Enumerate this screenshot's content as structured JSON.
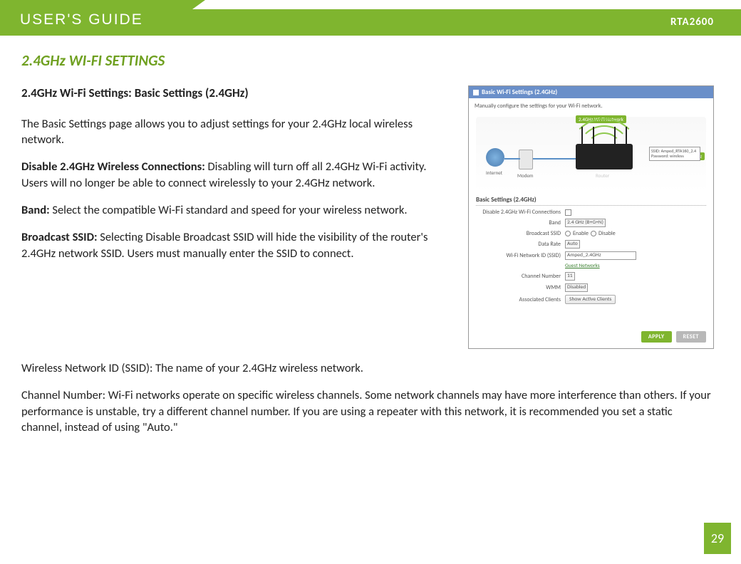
{
  "header": {
    "title": "USER'S GUIDE",
    "model": "RTA2600"
  },
  "section_title": "2.4GHz WI-FI SETTINGS",
  "sub_title": "2.4GHz Wi-Fi Settings: Basic Settings (2.4GHz)",
  "intro": "The Basic Settings page allows you to adjust settings for your 2.4GHz local wireless network.",
  "items": {
    "disable": {
      "label": "Disable 2.4GHz Wireless Connections: ",
      "text": "Disabling will turn off all 2.4GHz Wi-Fi activity. Users will no longer be able to connect wirelessly to your 2.4GHz network."
    },
    "band": {
      "label": "Band: ",
      "text": "Select the compatible Wi-Fi standard and speed for your wireless network."
    },
    "broadcast": {
      "label": "Broadcast SSID: ",
      "text": "Selecting Disable Broadcast SSID will hide the visibility of the router's 2.4GHz network SSID. Users must manually enter the SSID to connect."
    },
    "ssid": {
      "label": "Wireless Network ID (SSID): ",
      "text": "The name of your 2.4GHz wireless network."
    },
    "channel": {
      "label": "Channel Number: ",
      "text": "Wi-Fi networks operate on specific wireless channels. Some network channels may have more interference than others. If your performance is unstable, try a different channel number. If you are using a repeater with this network, it is recommended you set a static channel, instead of using \"Auto.\""
    }
  },
  "screenshot": {
    "panel_title": "Basic Wi-Fi Settings (2.4GHz)",
    "panel_desc": "Manually configure the settings for your Wi-Fi network.",
    "badge_network": "2.4GHz Wi-Fi Network",
    "badge_freq": "2.4GHz",
    "diagram_internet": "Internet",
    "diagram_modem": "Modem",
    "diagram_router": "Router",
    "ssid_box_line1": "SSID: Amped_RTA160_2.4",
    "ssid_box_line2": "Password: wireless",
    "form_title": "Basic Settings (2.4GHz)",
    "rows": {
      "disable": "Disable 2.4GHz Wi-Fi Connections",
      "band": "Band",
      "band_val": "2.4 GHz (B+G+N)",
      "broadcast": "Broadcast SSID",
      "broadcast_enable": "Enable",
      "broadcast_disable": "Disable",
      "datarate": "Data Rate",
      "datarate_val": "Auto",
      "ssid": "Wi-Fi Network ID (SSID)",
      "ssid_val": "Amped_2.4GHz",
      "guest": "Guest Networks",
      "channel": "Channel Number",
      "channel_val": "11",
      "wmm": "WMM",
      "wmm_val": "Disabled",
      "clients": "Associated Clients",
      "clients_btn": "Show Active Clients"
    },
    "apply": "APPLY",
    "reset": "RESET"
  },
  "page_number": "29"
}
